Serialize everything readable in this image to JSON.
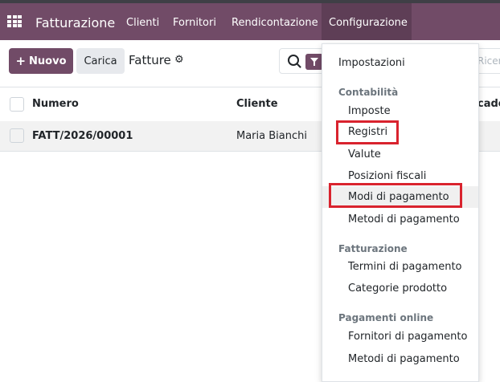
{
  "navbar": {
    "app_name": "Fatturazione",
    "menu": [
      "Clienti",
      "Fornitori",
      "Rendicontazione",
      "Configurazione"
    ],
    "active_menu": "Configurazione",
    "apps_icon": "grid-icon"
  },
  "control_panel": {
    "new_button": "Nuovo",
    "upload_button": "Carica",
    "breadcrumb": "Fatture",
    "settings_icon": "gear-icon",
    "search_placeholder": "Ricer"
  },
  "table": {
    "columns": [
      "Numero",
      "Cliente",
      "cade"
    ],
    "rows": [
      {
        "numero": "FATT/2026/00001",
        "cliente": "Maria Bianchi"
      }
    ]
  },
  "dropdown": {
    "items": [
      {
        "type": "item",
        "label": "Impostazioni"
      },
      {
        "type": "header",
        "label": "Contabilità"
      },
      {
        "type": "item",
        "label": "Imposte"
      },
      {
        "type": "item",
        "label": "Registri",
        "highlighted": true
      },
      {
        "type": "item",
        "label": "Valute"
      },
      {
        "type": "item",
        "label": "Posizioni fiscali"
      },
      {
        "type": "item",
        "label": "Modi di pagamento",
        "highlighted": true,
        "hover": true
      },
      {
        "type": "item",
        "label": "Metodi di pagamento"
      },
      {
        "type": "header",
        "label": "Fatturazione"
      },
      {
        "type": "item",
        "label": "Termini di pagamento"
      },
      {
        "type": "item",
        "label": "Categorie prodotto"
      },
      {
        "type": "header",
        "label": "Pagamenti online"
      },
      {
        "type": "item",
        "label": "Fornitori di pagamento"
      },
      {
        "type": "item",
        "label": "Metodi di pagamento"
      }
    ]
  },
  "colors": {
    "brand": "#714b67",
    "annotation": "#d9232e"
  }
}
